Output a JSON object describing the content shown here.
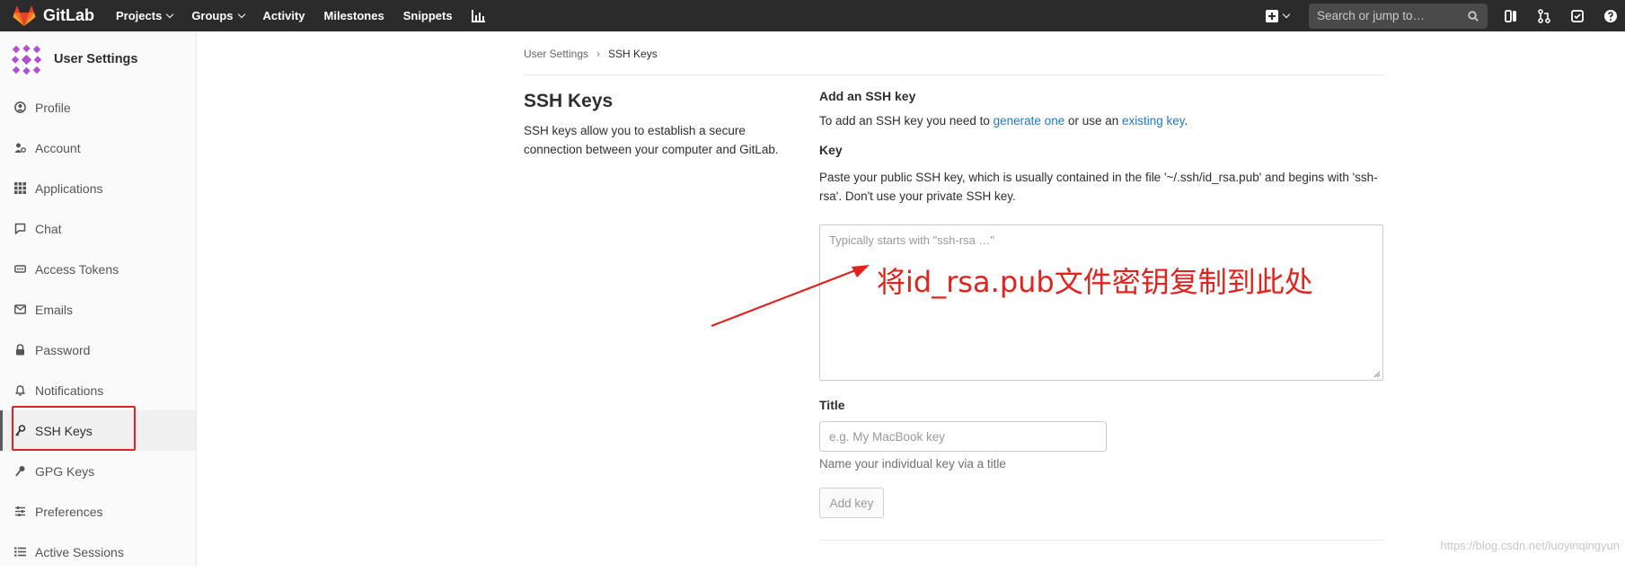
{
  "navbar": {
    "brand": "GitLab",
    "links": [
      {
        "label": "Projects",
        "dropdown": true
      },
      {
        "label": "Groups",
        "dropdown": true
      },
      {
        "label": "Activity",
        "dropdown": false
      },
      {
        "label": "Milestones",
        "dropdown": false
      },
      {
        "label": "Snippets",
        "dropdown": false
      }
    ],
    "search_placeholder": "Search or jump to…"
  },
  "sidebar": {
    "title": "User Settings",
    "items": [
      {
        "label": "Profile",
        "icon": "profile-icon"
      },
      {
        "label": "Account",
        "icon": "account-icon"
      },
      {
        "label": "Applications",
        "icon": "applications-icon"
      },
      {
        "label": "Chat",
        "icon": "chat-icon"
      },
      {
        "label": "Access Tokens",
        "icon": "access-tokens-icon"
      },
      {
        "label": "Emails",
        "icon": "emails-icon"
      },
      {
        "label": "Password",
        "icon": "password-icon"
      },
      {
        "label": "Notifications",
        "icon": "notifications-icon"
      },
      {
        "label": "SSH Keys",
        "icon": "ssh-key-icon",
        "active": true
      },
      {
        "label": "GPG Keys",
        "icon": "gpg-key-icon"
      },
      {
        "label": "Preferences",
        "icon": "preferences-icon"
      },
      {
        "label": "Active Sessions",
        "icon": "active-sessions-icon"
      }
    ]
  },
  "breadcrumb": {
    "parent": "User Settings",
    "current": "SSH Keys"
  },
  "intro": {
    "heading": "SSH Keys",
    "description": "SSH keys allow you to establish a secure connection between your computer and GitLab."
  },
  "form": {
    "add_heading": "Add an SSH key",
    "add_text_before": "To add an SSH key you need to ",
    "generate_link": "generate one",
    "add_text_middle": " or use an ",
    "existing_link": "existing key",
    "add_text_after": ".",
    "key_label": "Key",
    "key_help": "Paste your public SSH key, which is usually contained in the file '~/.ssh/id_rsa.pub' and begins with 'ssh-rsa'. Don't use your private SSH key.",
    "key_placeholder": "Typically starts with \"ssh-rsa …\"",
    "title_label": "Title",
    "title_placeholder": "e.g. My MacBook key",
    "title_help": "Name your individual key via a title",
    "submit_label": "Add key"
  },
  "annotation": "将id_rsa.pub文件密钥复制到此处",
  "watermark": "https://blog.csdn.net/luoyinqingyun",
  "colors": {
    "navbar_bg": "#2b2b2b",
    "link": "#1f78d1",
    "annotation_red": "#e0231e"
  }
}
